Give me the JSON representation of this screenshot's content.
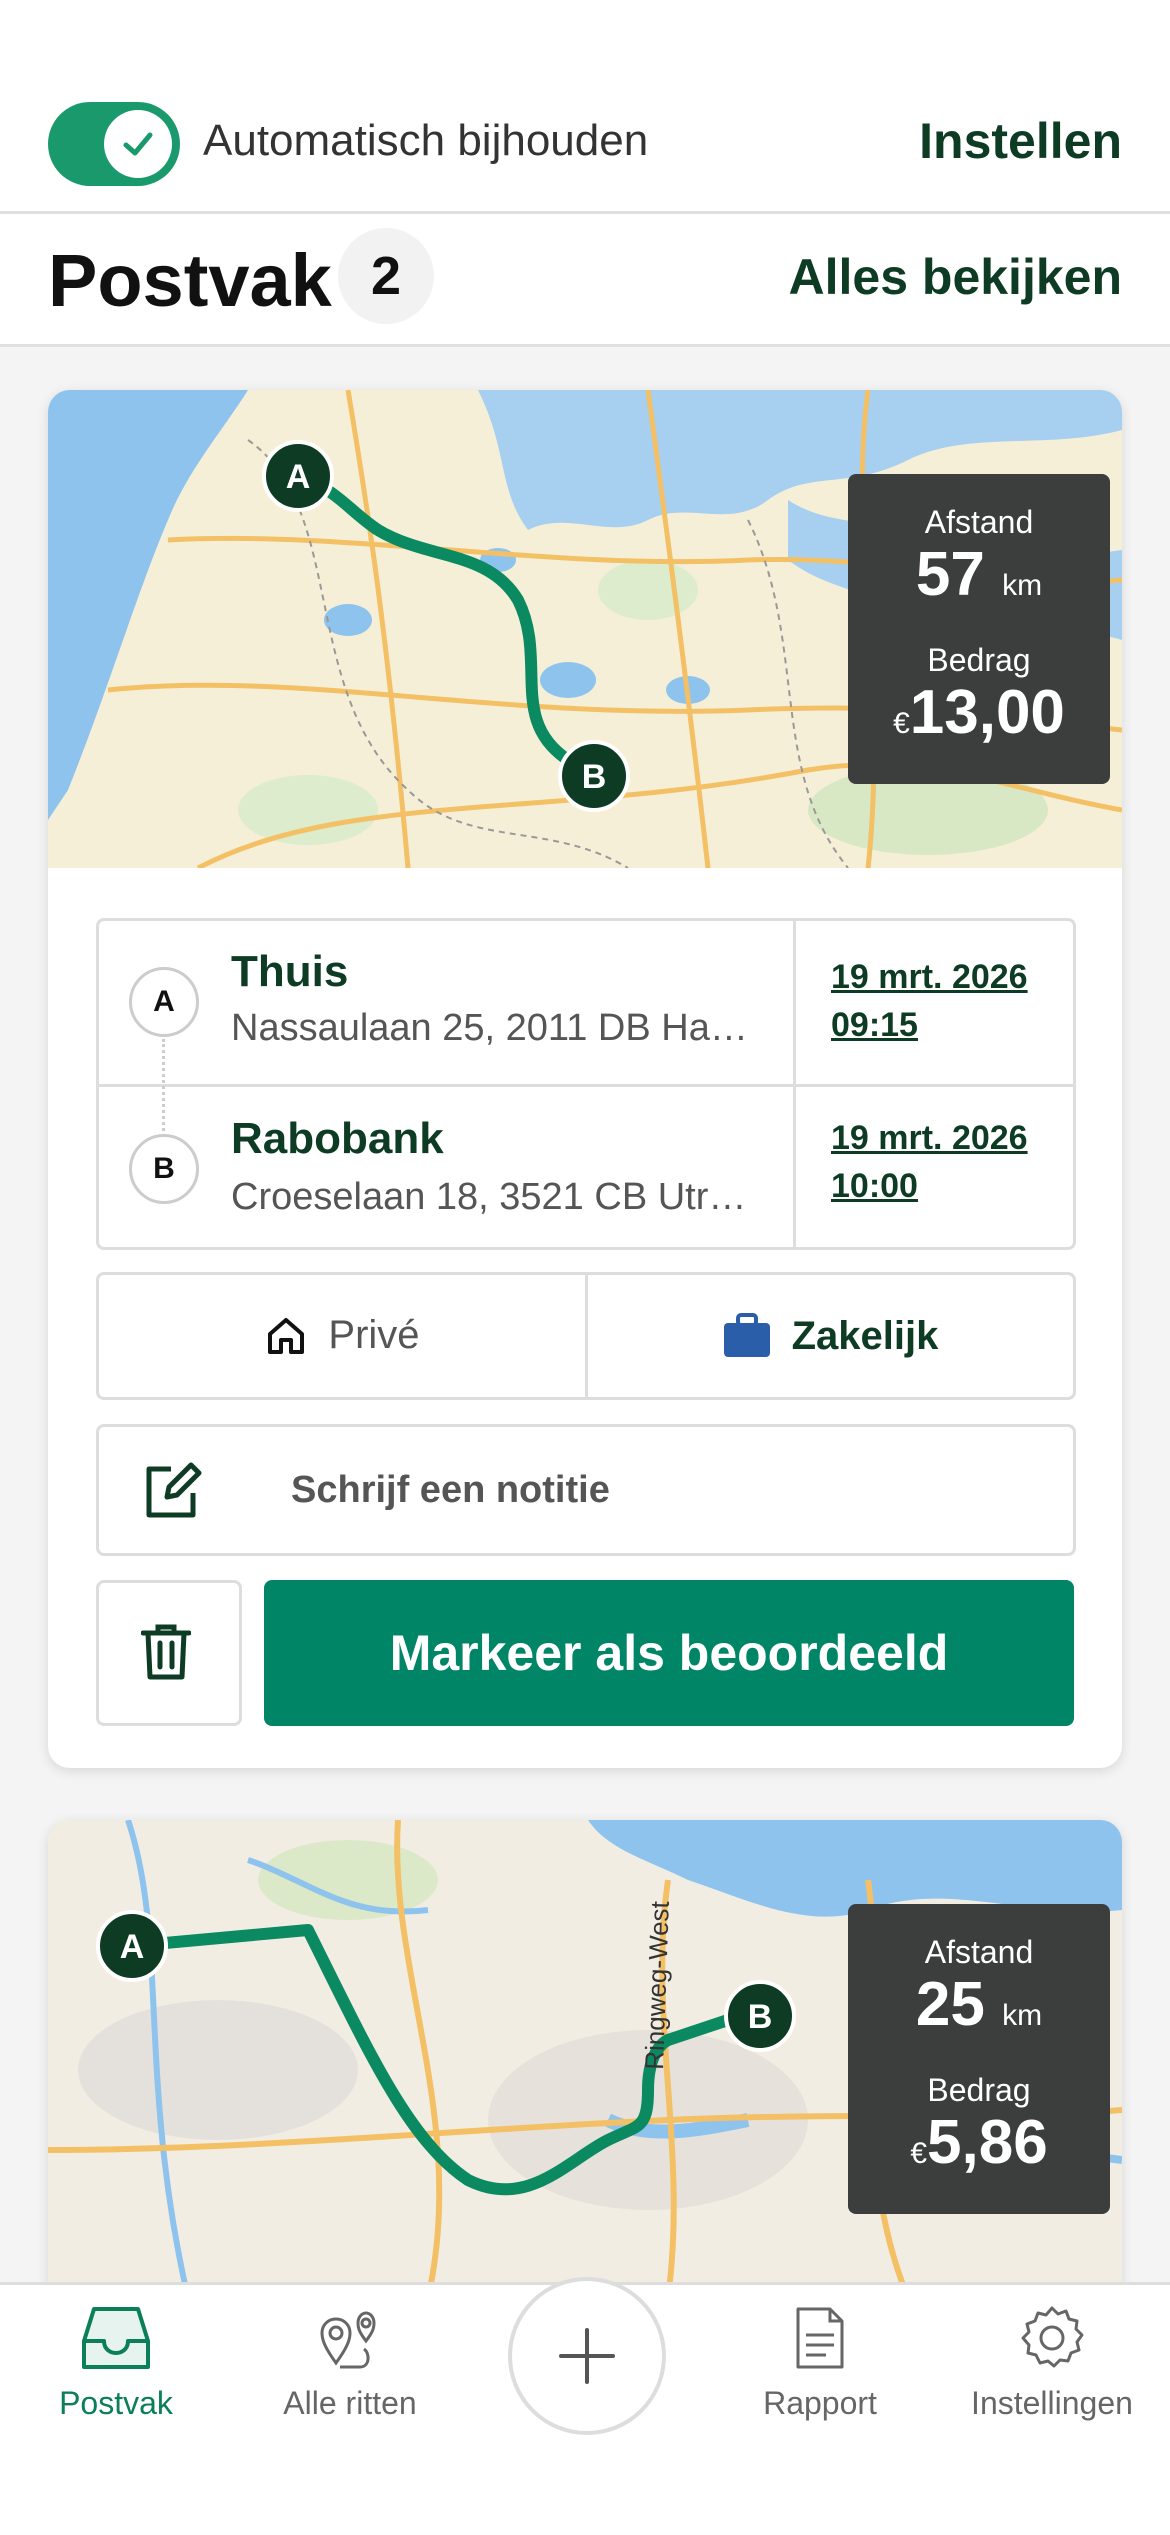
{
  "top": {
    "toggle_on": true,
    "auto_label": "Automatisch bijhouden",
    "settings_link": "Instellen"
  },
  "inbox": {
    "title": "Postvak",
    "count": "2",
    "view_all": "Alles bekijken"
  },
  "trips": [
    {
      "distance_label": "Afstand",
      "distance_value": "57",
      "distance_unit": "km",
      "amount_label": "Bedrag",
      "currency": "€",
      "amount_value": "13,00",
      "start": {
        "marker": "A",
        "name": "Thuis",
        "address": "Nassaulaan 25, 2011 DB Haa...",
        "date": "19 mrt. 2026",
        "time": "09:15"
      },
      "end": {
        "marker": "B",
        "name": "Rabobank",
        "address": "Croeselaan 18, 3521 CB Utre...",
        "date": "19 mrt. 2026",
        "time": "10:00"
      },
      "private_label": "Privé",
      "business_label": "Zakelijk",
      "note_placeholder": "Schrijf een notitie",
      "mark_reviewed": "Markeer als beoordeeld"
    },
    {
      "distance_label": "Afstand",
      "distance_value": "25",
      "distance_unit": "km",
      "amount_label": "Bedrag",
      "currency": "€",
      "amount_value": "5,86",
      "map_street_label": "Ringweg-West",
      "start": {
        "marker": "A"
      },
      "end": {
        "marker": "B"
      }
    }
  ],
  "nav": {
    "items": [
      {
        "label": "Postvak",
        "icon": "inbox-icon",
        "active": true
      },
      {
        "label": "Alle ritten",
        "icon": "route-pins-icon",
        "active": false
      },
      {
        "label": "Rapport",
        "icon": "document-icon",
        "active": false
      },
      {
        "label": "Instellingen",
        "icon": "gear-icon",
        "active": false
      }
    ],
    "add_icon": "plus-icon"
  },
  "colors": {
    "primary": "#008566",
    "toggle": "#1a9a6c",
    "dark_green_text": "#0d3b24",
    "route": "#0b8a62",
    "nav_active": "#0b7f57"
  }
}
